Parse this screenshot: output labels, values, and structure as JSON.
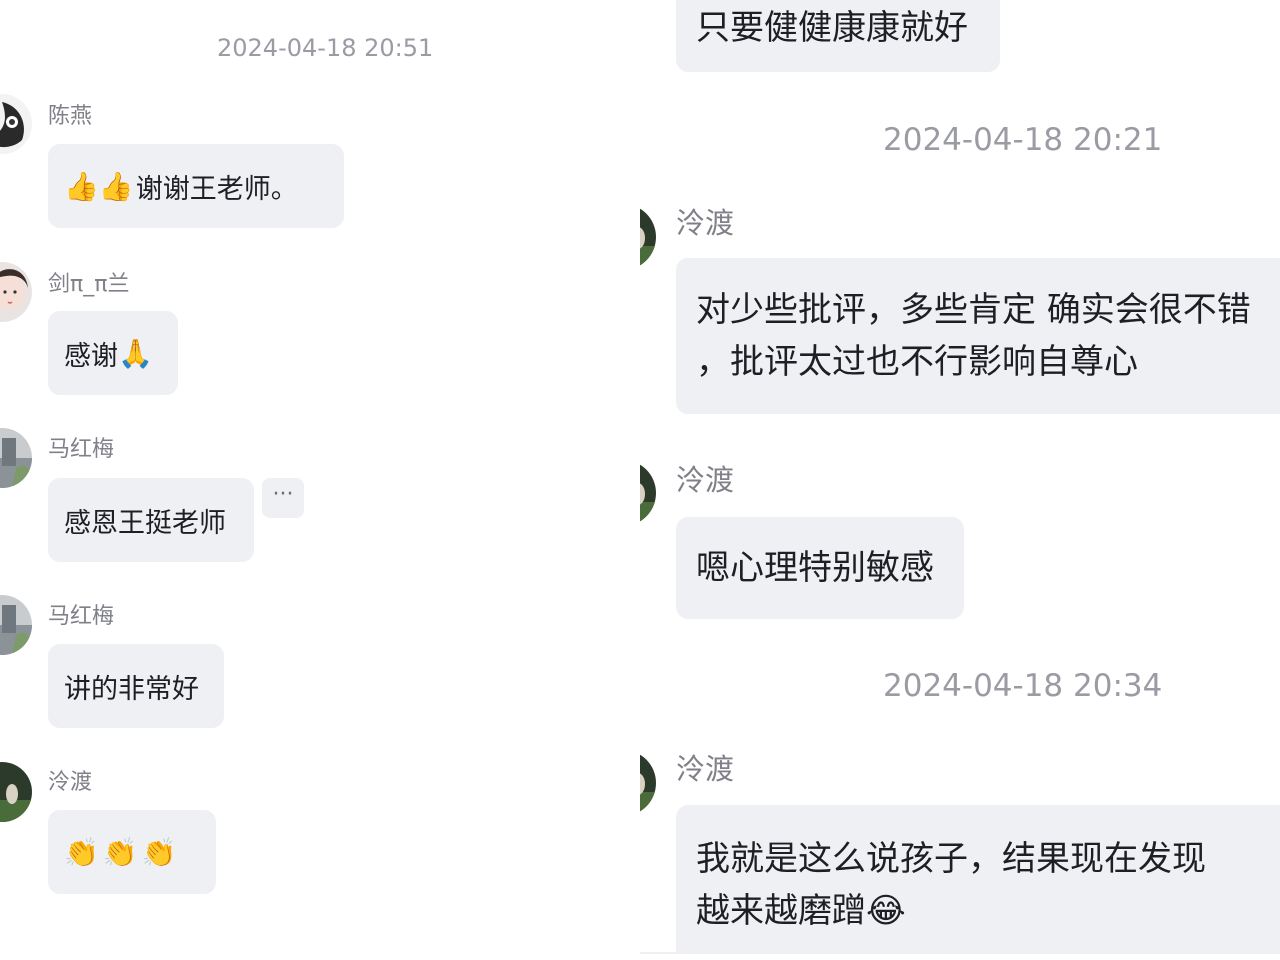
{
  "left": {
    "timestamp": "2024-04-18 20:51",
    "messages": [
      {
        "sender": "陈燕",
        "text": "谢谢王老师。",
        "emoji_prefix": "👍👍"
      },
      {
        "sender": "剑π_π兰",
        "text": "感谢",
        "emoji_suffix": "🙏"
      },
      {
        "sender": "马红梅",
        "text": "感恩王挺老师",
        "more_label": "···"
      },
      {
        "sender": "马红梅",
        "text": "讲的非常好"
      },
      {
        "sender": "泠渡",
        "emoji_only": "👏👏👏"
      }
    ]
  },
  "right": {
    "top_message": "只要健健康康就好",
    "timestamp_1": "2024-04-18 20:21",
    "messages_1": [
      {
        "sender": "泠渡",
        "line1": "对少些批评，多些肯定  确实会很不错",
        "line2": "，批评太过也不行影响自尊心"
      },
      {
        "sender": "泠渡",
        "text": "嗯心理特别敏感"
      }
    ],
    "timestamp_2": "2024-04-18 20:34",
    "messages_2": [
      {
        "sender": "泠渡",
        "line1": "我就是这么说孩子，结果现在发现",
        "line2": "越来越磨蹭",
        "emoji_suffix": "😂"
      }
    ]
  },
  "colors": {
    "bubble_bg": "#eff0f4",
    "timestamp": "#9a9ba3",
    "name": "#7f8089",
    "text": "#1e1f24"
  }
}
